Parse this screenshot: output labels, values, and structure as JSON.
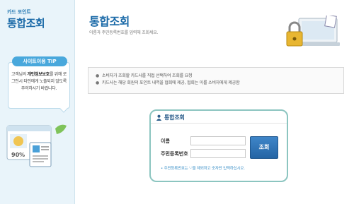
{
  "sidebar": {
    "brand_small": "카드 포인트",
    "brand_big": "통합조회",
    "tip_header": "사이트이용 TIP",
    "tip_text_pre": "고객님의 ",
    "tip_text_bold": "개인정보보호",
    "tip_text_post": "를 위해 로그인시 타인에게 노출되지 않도록 주의하시기 바랍니다."
  },
  "header": {
    "title": "통합조회",
    "subtitle": "이름과 주민등록번호를 입력해 조회세요."
  },
  "notice": {
    "items": [
      "소비자가 조회할 카드사를 직접 선택하여 조회를 요청",
      "카드사는 해당 회원의 포인트 내역을 협회에 제공, 협회는 이를 소비자에게 제공함"
    ]
  },
  "query_panel": {
    "title": "통합조회",
    "name_label": "이름",
    "id_label": "주민등록번호",
    "name_value": "",
    "id_value": "",
    "submit_label": "조회",
    "note": "• 주민등록번호는 '-'을 제외하고 숫자만 입력하십시오."
  },
  "illustration": {
    "gauge_text": "90%"
  },
  "colors": {
    "accent": "#1b6aa8",
    "panel_border": "#8cc5c0",
    "tip_header": "#49a8dc",
    "button": "#2f75b8"
  }
}
